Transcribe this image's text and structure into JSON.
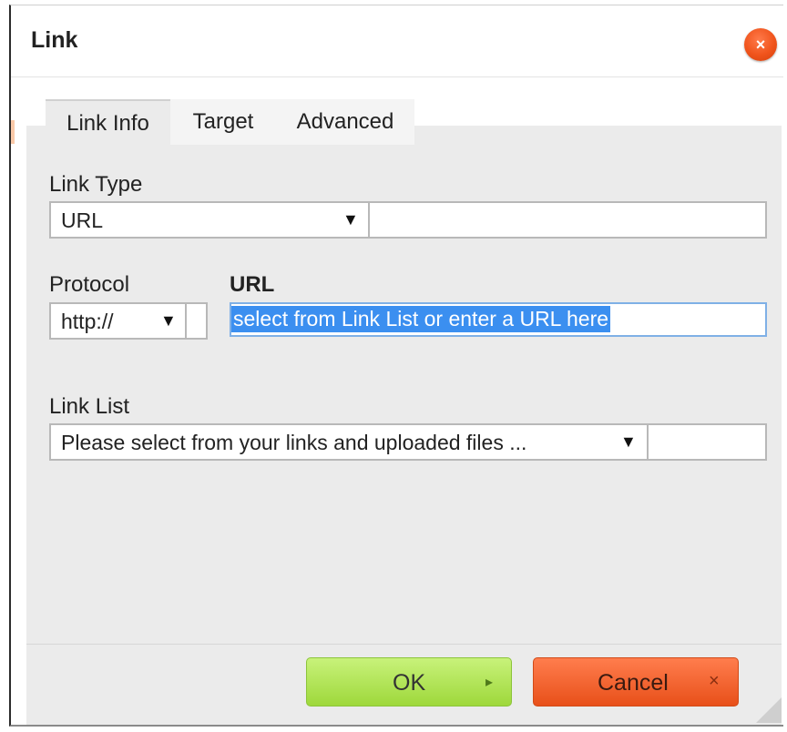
{
  "dialog": {
    "title": "Link",
    "close_icon": "×"
  },
  "tabs": [
    {
      "label": "Link Info",
      "active": true
    },
    {
      "label": "Target",
      "active": false
    },
    {
      "label": "Advanced",
      "active": false
    }
  ],
  "link_info": {
    "link_type_label": "Link Type",
    "link_type_value": "URL",
    "protocol_label": "Protocol",
    "protocol_value": "http://",
    "url_label": "URL",
    "url_value": "select from Link List or enter a URL here",
    "link_list_label": "Link List",
    "link_list_value": "Please select from your links and uploaded files ..."
  },
  "icons": {
    "dropdown": "▼",
    "ok": "▸",
    "cancel": "×"
  },
  "footer": {
    "ok_label": "OK",
    "cancel_label": "Cancel"
  },
  "colors": {
    "ok_button": "#a8e04a",
    "cancel_button": "#f05a22",
    "close_button": "#f0541c",
    "selection": "#3b8ff0"
  }
}
